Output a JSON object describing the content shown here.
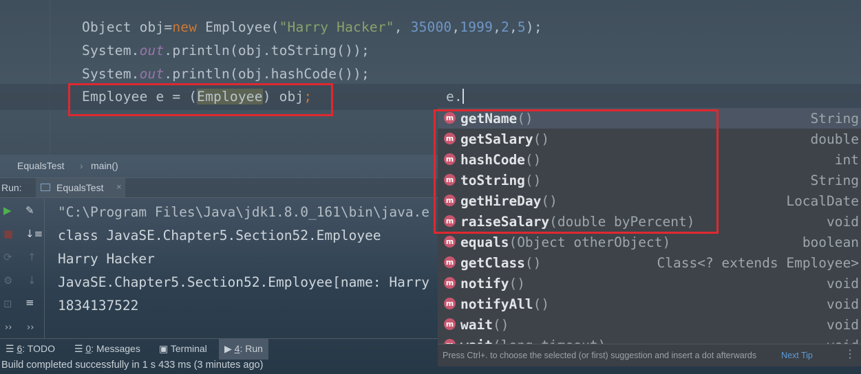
{
  "editor": {
    "line1": {
      "a": "Object obj=",
      "kw_new": "new",
      "b": " Employee(",
      "str": "\"Harry Hacker\"",
      "c": ", ",
      "n1": "35000",
      "c2": ",",
      "n2": "1999",
      "c3": ",",
      "n3": "2",
      "c4": ",",
      "n4": "5",
      "d": ");"
    },
    "line2": {
      "a": "System.",
      "field": "out",
      "b": ".println(obj.toString());"
    },
    "line3": {
      "a": "System.",
      "field": "out",
      "b": ".println(obj.hashCode());"
    },
    "line4": {
      "a": "Employee e = (",
      "cast": "Employee",
      "b": ") obj",
      "semi": ";"
    },
    "typed": "e."
  },
  "breadcrumb": {
    "cls": "EqualsTest",
    "sep": "›",
    "method": "main()"
  },
  "run": {
    "label": "Run:",
    "tab": "EqualsTest",
    "close": "×"
  },
  "console": [
    "\"C:\\Program Files\\Java\\jdk1.8.0_161\\bin\\java.e",
    "class JavaSE.Chapter5.Section52.Employee",
    "Harry Hacker",
    "JavaSE.Chapter5.Section52.Employee[name: Harry",
    "1834137522"
  ],
  "completion": {
    "items": [
      {
        "icon": "m",
        "name": "getName",
        "params": "()",
        "type": "String"
      },
      {
        "icon": "m",
        "name": "getSalary",
        "params": "()",
        "type": "double"
      },
      {
        "icon": "m",
        "name": "hashCode",
        "params": "()",
        "type": "int"
      },
      {
        "icon": "m",
        "name": "toString",
        "params": "()",
        "type": "String"
      },
      {
        "icon": "m",
        "name": "getHireDay",
        "params": "()",
        "type": "LocalDate"
      },
      {
        "icon": "m",
        "name": "raiseSalary",
        "params": "(double byPercent)",
        "type": "void"
      },
      {
        "icon": "m",
        "name": "equals",
        "params": "(Object otherObject)",
        "type": "boolean"
      },
      {
        "icon": "m",
        "name": "getClass",
        "params": "()",
        "type": "Class<? extends Employee>"
      },
      {
        "icon": "m",
        "name": "notify",
        "params": "()",
        "type": "void"
      },
      {
        "icon": "m",
        "name": "notifyAll",
        "params": "()",
        "type": "void"
      },
      {
        "icon": "m",
        "name": "wait",
        "params": "()",
        "type": "void"
      },
      {
        "icon": "m",
        "name": "wait",
        "params": "(long timeout)",
        "type": "void"
      }
    ],
    "hint": "Press Ctrl+. to choose the selected (or first) suggestion and insert a dot afterwards",
    "next_tip": "Next Tip",
    "more": "⋮"
  },
  "toolwindows": {
    "todo": {
      "num": "6",
      "label": ": TODO"
    },
    "messages": {
      "num": "0",
      "label": ": Messages"
    },
    "terminal": "Terminal",
    "run": {
      "num": "4",
      "label": ": Run"
    }
  },
  "status": "Build completed successfully in 1 s 433 ms (3 minutes ago)",
  "colors": {
    "highlight_box": "#e0282f",
    "method_icon": "#c8566e",
    "link": "#5d9bd6"
  }
}
